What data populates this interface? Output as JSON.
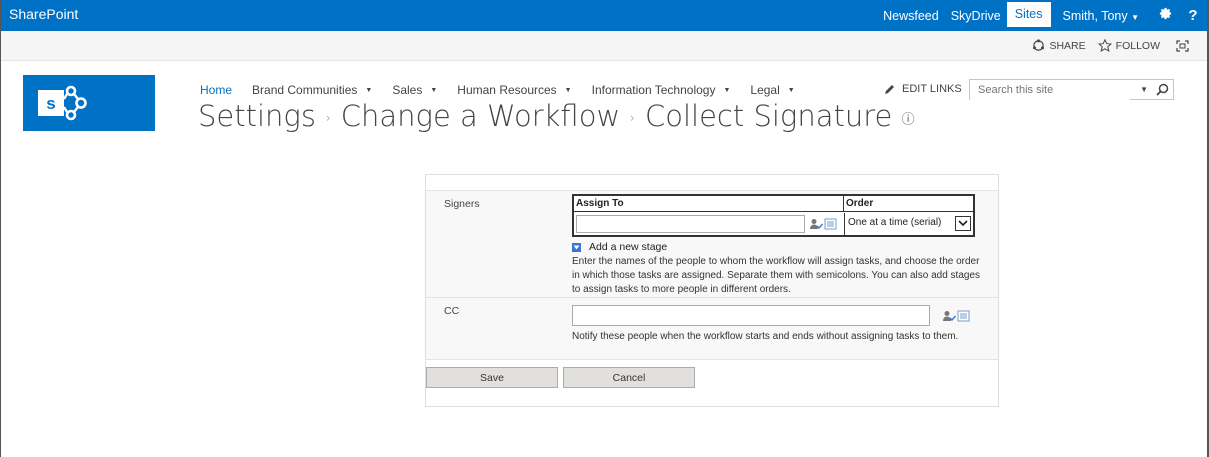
{
  "suitebar": {
    "brand": "SharePoint",
    "links": [
      "Newsfeed",
      "SkyDrive",
      "Sites"
    ],
    "active_link": "Sites",
    "user": "Smith, Tony",
    "accent_color": "#0072c6"
  },
  "ribbon": {
    "share_label": "SHARE",
    "follow_label": "FOLLOW"
  },
  "nav": {
    "items": [
      {
        "label": "Home"
      },
      {
        "label": "Brand Communities"
      },
      {
        "label": "Sales"
      },
      {
        "label": "Human Resources"
      },
      {
        "label": "Information Technology"
      },
      {
        "label": "Legal"
      }
    ],
    "edit_links_label": "EDIT LINKS"
  },
  "search": {
    "placeholder": "Search this site"
  },
  "breadcrumb": {
    "items": [
      "Settings",
      "Change a Workflow",
      "Collect Signature"
    ]
  },
  "form": {
    "signers": {
      "label": "Signers",
      "assign_header": "Assign To",
      "order_header": "Order",
      "assign_value": "",
      "order_value": "One at a time (serial)",
      "add_stage_label": "Add a new stage",
      "description": "Enter the names of the people to whom the workflow will assign tasks, and choose the order in which those tasks are assigned. Separate them with semicolons. You can also add stages to assign tasks to more people in different orders."
    },
    "cc": {
      "label": "CC",
      "value": "",
      "description": "Notify these people when the workflow starts and ends without assigning tasks to them."
    },
    "save_label": "Save",
    "cancel_label": "Cancel"
  }
}
